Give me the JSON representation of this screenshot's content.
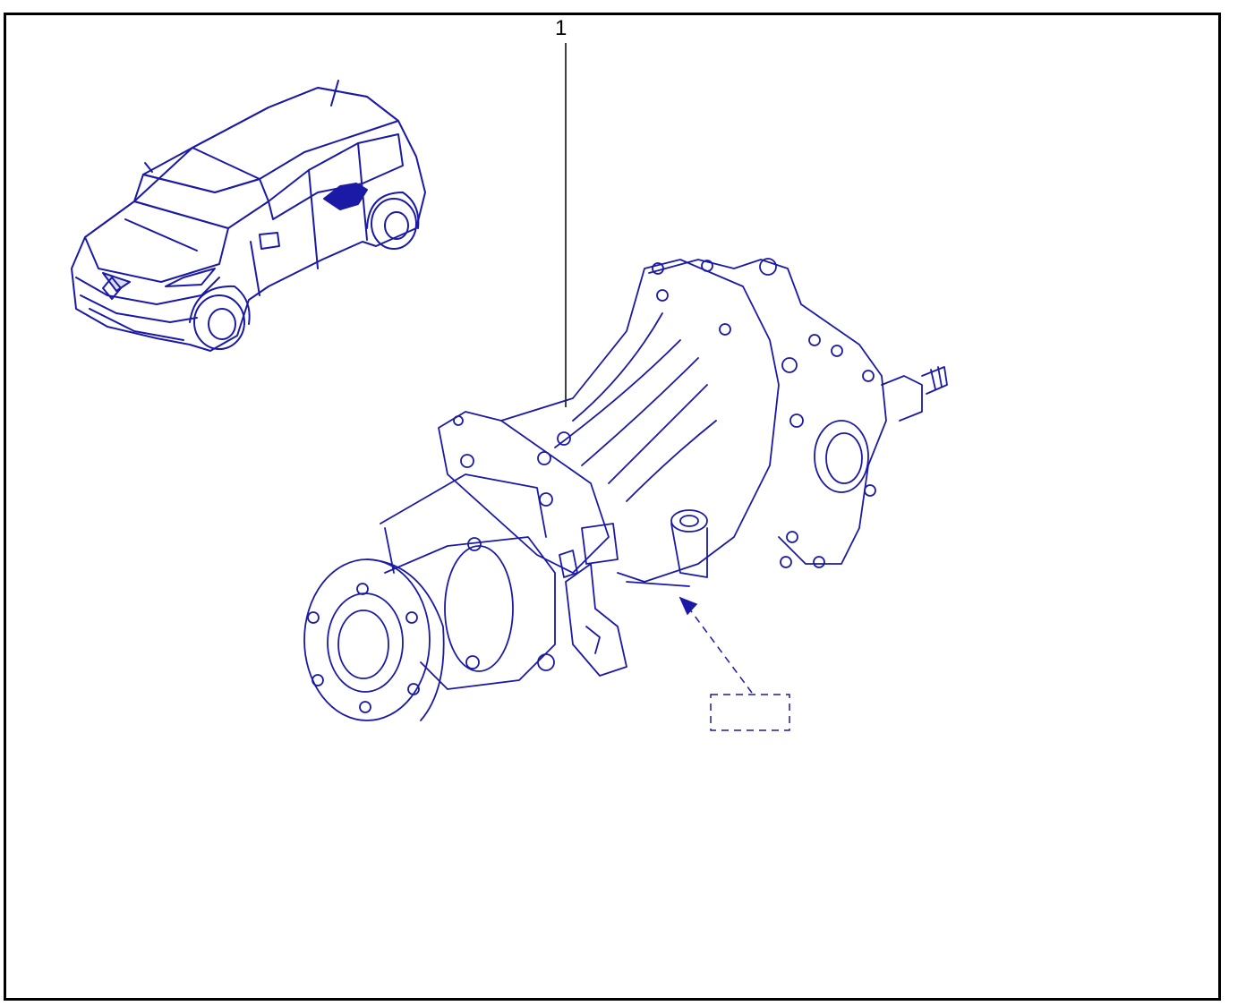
{
  "diagram": {
    "callouts": [
      {
        "label": "1"
      }
    ],
    "colors": {
      "line": "#1a1aa6",
      "frame": "#000000",
      "background": "#ffffff"
    },
    "components": [
      {
        "name": "vehicle-locator",
        "icon": "car-icon"
      },
      {
        "name": "rear-differential-assembly",
        "icon": "differential-icon"
      },
      {
        "name": "label-placeholder",
        "icon": "dashed-box-icon"
      }
    ]
  }
}
